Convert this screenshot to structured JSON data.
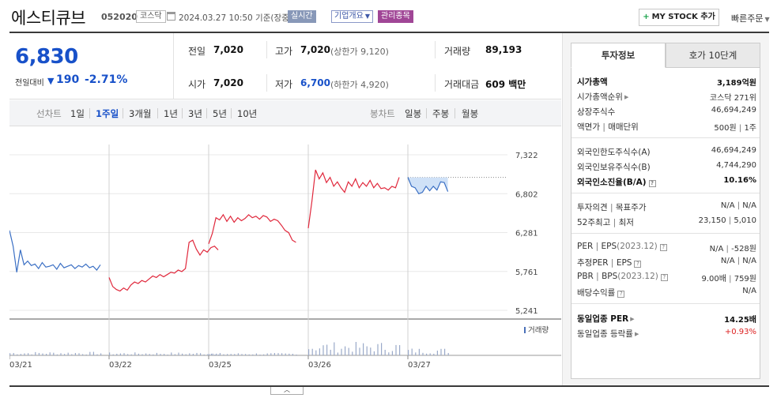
{
  "header": {
    "name": "에스티큐브",
    "code": "052020",
    "market": "코스닥",
    "timestamp": "2024.03.27 10:50 기준(장중)",
    "badge_realtime": "실시간",
    "badge_corp": "기업개요",
    "badge_mgmt": "관리종목",
    "mystock_label": "MY STOCK 추가",
    "quick_order": "빠른주문"
  },
  "quote": {
    "price": "6,830",
    "change_label": "전일대비",
    "change_value": "190",
    "change_pct": "-2.71%",
    "prev_label": "전일",
    "prev_value": "7,020",
    "open_label": "시가",
    "open_value": "7,020",
    "high_label": "고가",
    "high_value": "7,020",
    "high_sub": "(상한가 9,120)",
    "low_label": "저가",
    "low_value": "6,700",
    "low_sub": "(하한가 4,920)",
    "volume_label": "거래량",
    "volume_value": "89,193",
    "amount_label": "거래대금",
    "amount_value": "609 백만"
  },
  "tabs": {
    "line_label": "선차트",
    "line_tabs": [
      "1일",
      "1주일",
      "3개월",
      "1년",
      "3년",
      "5년",
      "10년"
    ],
    "line_active": 1,
    "candle_label": "봉차트",
    "candle_tabs": [
      "일봉",
      "주봉",
      "월봉"
    ]
  },
  "chart_data": {
    "type": "line",
    "y_ticks": [
      "7,322",
      "6,802",
      "6,281",
      "5,761",
      "5,241"
    ],
    "ylim": [
      5241,
      7322
    ],
    "x_ticks": [
      "03/21",
      "03/22",
      "03/25",
      "03/26",
      "03/27"
    ],
    "previous_close": 7020,
    "volume_legend": "거래량",
    "series": [
      {
        "day": "03/21",
        "values": [
          6310,
          6100,
          5750,
          6050,
          5850,
          5900,
          5840,
          5860,
          5800,
          5880,
          5820,
          5830,
          5850,
          5790,
          5870,
          5810,
          5830,
          5850,
          5800,
          5840,
          5820,
          5860,
          5810,
          5830,
          5780,
          5850
        ]
      },
      {
        "day": "03/22",
        "values": [
          5680,
          5560,
          5520,
          5500,
          5540,
          5510,
          5580,
          5620,
          5600,
          5640,
          5620,
          5660,
          5700,
          5680,
          5720,
          5690,
          5720,
          5750,
          5740,
          5780,
          5760,
          5800,
          6150,
          6180,
          6060,
          5980,
          6050,
          6020,
          6080,
          6100,
          6050
        ]
      },
      {
        "day": "03/25",
        "values": [
          6130,
          6270,
          6480,
          6450,
          6520,
          6430,
          6500,
          6420,
          6480,
          6440,
          6470,
          6520,
          6480,
          6500,
          6460,
          6510,
          6490,
          6430,
          6460,
          6440,
          6380,
          6310,
          6280,
          6180,
          6150
        ]
      },
      {
        "day": "03/26",
        "values": [
          6340,
          6700,
          7120,
          7000,
          7080,
          6950,
          7020,
          6900,
          6960,
          6880,
          6820,
          6960,
          6900,
          7000,
          6880,
          6950,
          6900,
          6980,
          6880,
          6940,
          6870,
          6880,
          6850,
          6900,
          6880,
          7020
        ]
      },
      {
        "day": "03/27",
        "values": [
          7020,
          6900,
          6880,
          6800,
          6820,
          6900,
          6840,
          6900,
          6850,
          6960,
          6950,
          6830
        ]
      }
    ],
    "volume_day_share": [
      0.12,
      0.1,
      0.08,
      0.45,
      0.25
    ]
  },
  "right_panel": {
    "tab_active": "투자정보",
    "tab_other": "호가 10단계",
    "rows": [
      {
        "key": "시가총액",
        "value": "3,189억원",
        "bold": true
      },
      {
        "key": "시가총액순위",
        "value": "코스닥 271위",
        "caret": true
      },
      {
        "key": "상장주식수",
        "value": "46,694,249"
      },
      {
        "key": "액면가",
        "key2": "매매단위",
        "value": "500원",
        "value2": "1주"
      },
      {
        "key": "외국인한도주식수(A)",
        "value": "46,694,249"
      },
      {
        "key": "외국인보유주식수(B)",
        "value": "4,744,290"
      },
      {
        "key": "외국인소진율(B/A)",
        "value": "10.16%",
        "bold": true,
        "help": true
      },
      {
        "key": "투자의견",
        "key2": "목표주가",
        "value": "N/A",
        "value2": "N/A"
      },
      {
        "key": "52주최고",
        "key2": "최저",
        "value": "23,150",
        "value2": "5,010"
      },
      {
        "key": "PER",
        "key2": "EPS",
        "note": "(2023.12)",
        "value": "N/A",
        "value2": "-528원",
        "help": true
      },
      {
        "key": "추정PER",
        "key2": "EPS",
        "value": "N/A",
        "value2": "N/A",
        "help": true
      },
      {
        "key": "PBR",
        "key2": "BPS",
        "note": "(2023.12)",
        "value": "9.00배",
        "value2": "759원",
        "help": true
      },
      {
        "key": "배당수익률",
        "value": "N/A",
        "help": true
      },
      {
        "key": "동일업종 PER",
        "value": "14.25배",
        "bold": true,
        "caret": true
      },
      {
        "key": "동일업종 등락률",
        "value": "+0.93%",
        "red": true,
        "caret": true
      }
    ]
  },
  "colors": {
    "price_down": "#1851c9",
    "line_before": "#3a6fc4",
    "line_after": "#e0283c",
    "area_today": "#cfe1f7",
    "badge_mgmt": "#a04696"
  },
  "icons": {
    "calendar": "calendar-icon",
    "down_arrow": "triangle-down-icon",
    "plus": "plus-icon",
    "collapse": "chevron-up-icon"
  }
}
